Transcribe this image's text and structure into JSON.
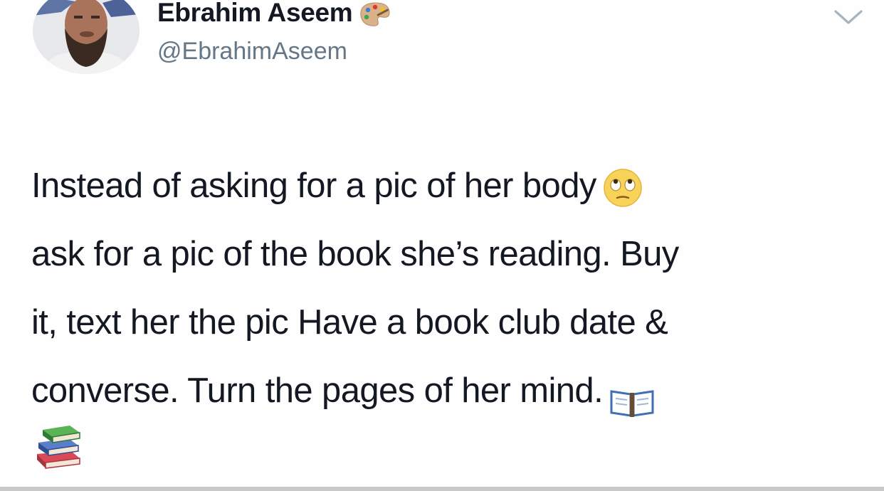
{
  "tweet": {
    "display_name": "Ebrahim Aseem",
    "handle": "@EbrahimAseem",
    "name_emoji_icon": "artist-palette-icon",
    "menu_icon": "chevron-down-icon",
    "body_lines": [
      "Instead of asking for a pic of her body",
      "ask for a pic of the book she’s reading. Buy",
      "it, text her the pic Have a book club date &",
      "converse. Turn the pages of her mind."
    ],
    "emojis": [
      "face-with-rolling-eyes-icon",
      "open-book-icon",
      "books-icon"
    ]
  },
  "colors": {
    "text": "#141823",
    "handle": "#657786",
    "background": "#ffffff"
  }
}
